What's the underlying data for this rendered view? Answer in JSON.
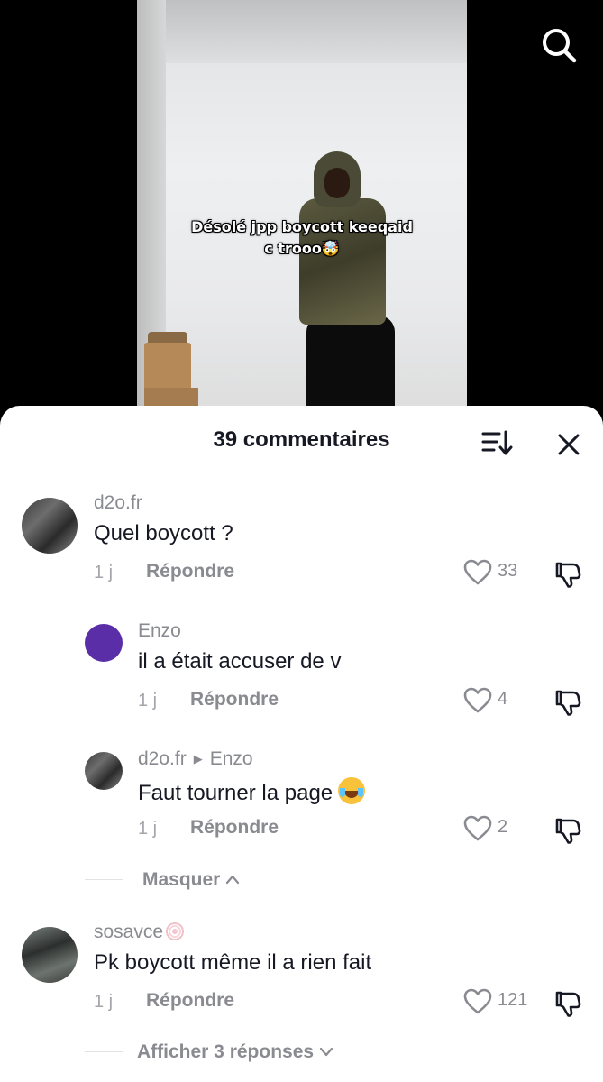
{
  "video": {
    "caption_line1": "Désolé jpp boycott keeqaid",
    "caption_line2": "c trooo🤯"
  },
  "comments_sheet": {
    "title": "39 commentaires",
    "comments": [
      {
        "username": "d2o.fr",
        "text": "Quel boycott ?",
        "time": "1 j",
        "reply_label": "Répondre",
        "likes": "33",
        "replies": [
          {
            "username": "Enzo",
            "text": "il a était accuser de v",
            "time": "1 j",
            "reply_label": "Répondre",
            "likes": "4"
          },
          {
            "username": "d2o.fr",
            "reply_to": "Enzo",
            "text": "Faut tourner la page",
            "time": "1 j",
            "reply_label": "Répondre",
            "likes": "2"
          }
        ],
        "hide_label": "Masquer"
      },
      {
        "username": "sosavce",
        "text": "Pk boycott même il a rien fait",
        "time": "1 j",
        "reply_label": "Répondre",
        "likes": "121",
        "show_replies_label": "Afficher 3 réponses"
      }
    ]
  },
  "icons": {
    "search": "search-icon",
    "sort": "sort-icon",
    "close": "close-icon",
    "like": "heart-icon",
    "dislike": "thumbs-down-icon",
    "chevron_up": "chevron-up-icon",
    "chevron_down": "chevron-down-icon",
    "reply_arrow": "caret-right-icon"
  },
  "colors": {
    "sheet_bg": "#ffffff",
    "text_primary": "#161823",
    "text_secondary": "#8a8b91",
    "avatar_purple": "#5a2ea6"
  }
}
